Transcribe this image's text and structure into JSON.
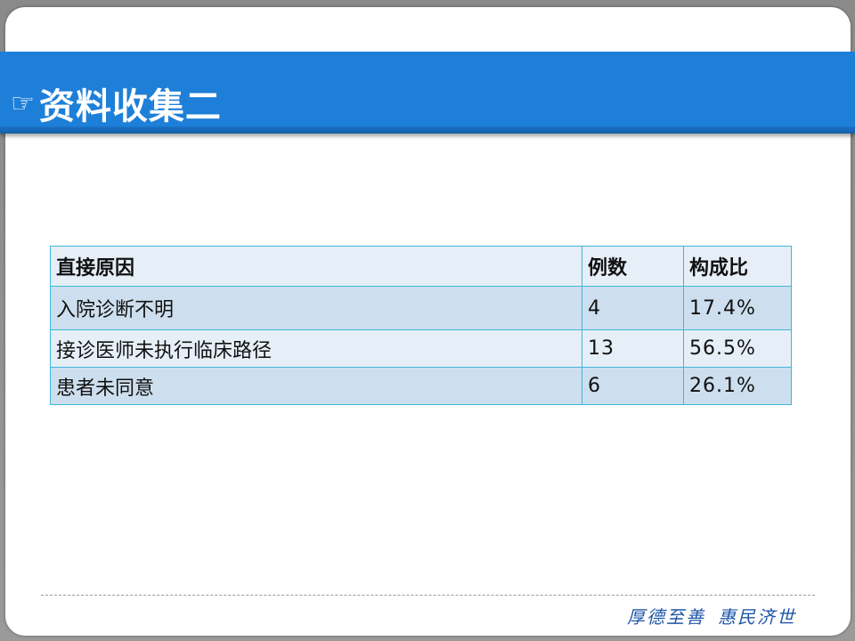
{
  "slide": {
    "title_icon": "☞",
    "title": "资料收集二",
    "motto_left": "厚德至善",
    "motto_right": "惠民济世"
  },
  "table": {
    "headers": [
      "直接原因",
      "例数",
      "构成比"
    ],
    "rows": [
      [
        "入院诊断不明",
        "4",
        "17.4%"
      ],
      [
        "接诊医师未执行临床路径",
        "13",
        "56.5%"
      ],
      [
        "患者未同意",
        "6",
        "26.1%"
      ]
    ]
  },
  "colors": {
    "title_band": "#1e7fd8",
    "table_border": "#3fb6dc",
    "row_dark": "#cddfee",
    "row_light": "#e6eff8",
    "motto": "#1f56a8"
  }
}
